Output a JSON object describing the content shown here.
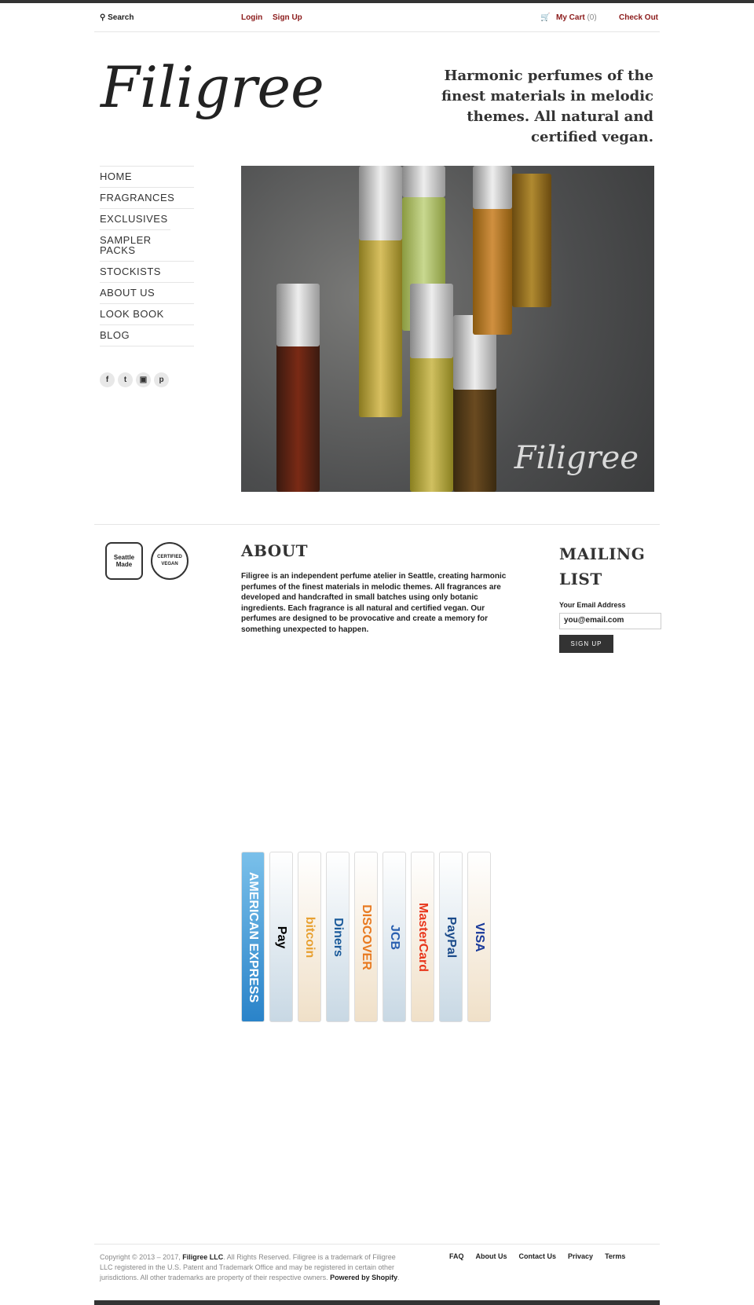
{
  "topbar": {
    "search": "Search",
    "login": "Login",
    "signup": "Sign Up",
    "cart": "My Cart",
    "cart_count": "(0)",
    "checkout": "Check Out"
  },
  "brand": {
    "logo": "Filigree",
    "tagline": "Harmonic perfumes of the finest materials in melodic themes. All natural and certified vegan."
  },
  "nav": [
    "HOME",
    "FRAGRANCES",
    "EXCLUSIVES",
    "SAMPLER PACKS",
    "STOCKISTS",
    "ABOUT US",
    "LOOK BOOK",
    "BLOG"
  ],
  "social": [
    "facebook-icon",
    "twitter-icon",
    "instagram-icon",
    "pinterest-icon"
  ],
  "badges": {
    "seattle": "Seattle Made",
    "vegan": "CERTIFIED VEGAN"
  },
  "about": {
    "title": "ABOUT",
    "body": "Filigree is an independent perfume atelier in Seattle, creating harmonic perfumes of the finest materials in melodic themes. All fragrances are developed and handcrafted in small batches using only botanic ingredients. Each fragrance is all natural and certified vegan. Our perfumes are designed to be provocative and create a memory for something unexpected to happen."
  },
  "mailing": {
    "title": "MAILING LIST",
    "label": "Your Email Address",
    "placeholder": "you@email.com",
    "button": "SIGN UP"
  },
  "payments": [
    {
      "name": "AMERICAN EXPRESS",
      "color": "#2a83c9"
    },
    {
      "name": "Pay",
      "color": "#000000"
    },
    {
      "name": "bitcoin",
      "color": "#e8a030"
    },
    {
      "name": "Diners",
      "color": "#1a5a9a"
    },
    {
      "name": "DISCOVER",
      "color": "#e87a20"
    },
    {
      "name": "JCB",
      "color": "#2a60b0"
    },
    {
      "name": "MasterCard",
      "color": "#e8361b"
    },
    {
      "name": "PayPal",
      "color": "#1a4a8a"
    },
    {
      "name": "VISA",
      "color": "#1a3a9a"
    }
  ],
  "footer": {
    "copyright_pre": "Copyright © 2013 – 2017, ",
    "company": "Filigree LLC",
    "copyright_post": ". All Rights Reserved. Filigree is a trademark of Filigree LLC registered in the U.S. Patent and Trademark Office and may be registered in certain other jurisdictions. All other trademarks are property of their respective owners. ",
    "powered": "Powered by Shopify",
    "links": [
      "FAQ",
      "About Us",
      "Contact Us",
      "Privacy",
      "Terms"
    ]
  }
}
